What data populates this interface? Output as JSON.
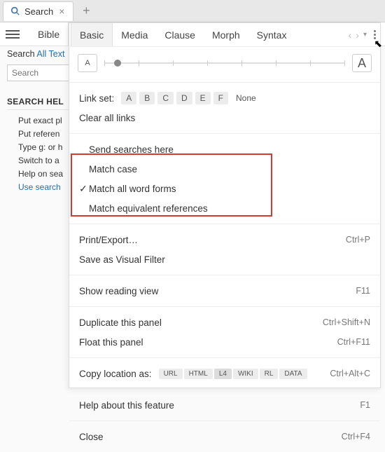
{
  "tab": {
    "title": "Search",
    "close_glyph": "×",
    "new_glyph": "+"
  },
  "categories": [
    "Bible",
    "Basic",
    "Media",
    "Clause",
    "Morph",
    "Syntax"
  ],
  "activeCategory": "Basic",
  "nav": {
    "left": "‹",
    "right": "›",
    "down": "▾"
  },
  "left": {
    "search_label": "Search",
    "search_link": "All Text",
    "placeholder": "Search",
    "help_heading": "SEARCH HEL",
    "tips": [
      "Put exact pl",
      "Put referen",
      "Type g: or h",
      "Switch to a",
      "Help on sea"
    ],
    "tips_link": "Use search"
  },
  "font_row": {
    "small_label": "A",
    "big_label": "A"
  },
  "linkset": {
    "label": "Link set:",
    "options": [
      "A",
      "B",
      "C",
      "D",
      "E",
      "F",
      "None"
    ],
    "clear": "Clear all links"
  },
  "options": {
    "send": "Send searches here",
    "match_case": "Match case",
    "match_forms": "Match all word forms",
    "match_forms_checked": true,
    "match_refs": "Match equivalent references"
  },
  "export": {
    "print": "Print/Export…",
    "print_sc": "Ctrl+P",
    "save_filter": "Save as Visual Filter"
  },
  "view": {
    "reading": "Show reading view",
    "reading_sc": "F11"
  },
  "panel_ops": {
    "dup": "Duplicate this panel",
    "dup_sc": "Ctrl+Shift+N",
    "float": "Float this panel",
    "float_sc": "Ctrl+F11"
  },
  "copy": {
    "label": "Copy location as:",
    "formats": [
      "URL",
      "HTML",
      "L4",
      "WIKI",
      "RL",
      "DATA"
    ],
    "selected": "L4",
    "sc": "Ctrl+Alt+C"
  },
  "footer": {
    "help": "Help about this feature",
    "help_sc": "F1",
    "close": "Close",
    "close_sc": "Ctrl+F4"
  },
  "cursor_glyph": "↖"
}
